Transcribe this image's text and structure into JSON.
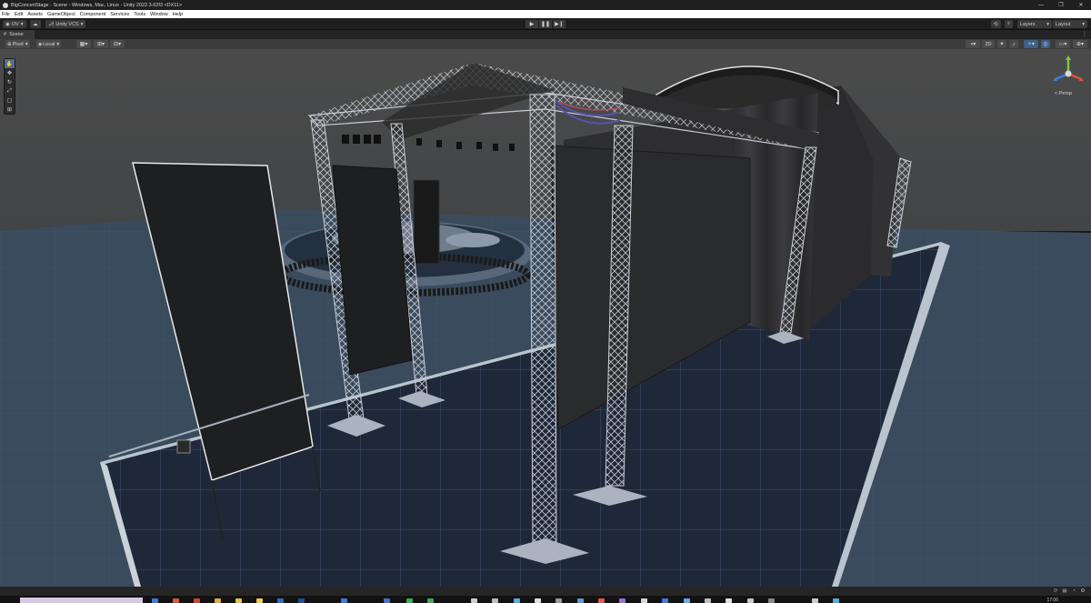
{
  "window": {
    "title": "BigConcertStage - Scene - Windows, Mac, Linux - Unity 2022.3.62f3 <DX11>",
    "controls": [
      "—",
      "❐",
      "✕"
    ]
  },
  "menu": [
    "File",
    "Edit",
    "Assets",
    "GameObject",
    "Component",
    "Services",
    "Tools",
    "Window",
    "Help"
  ],
  "toolbar": {
    "account": "OV",
    "vcs": "Unity VCS",
    "play": "▶",
    "pause": "❚❚",
    "step": "▶❙",
    "layers": "Layers",
    "layout": "Layout"
  },
  "scene_tab": {
    "label": "Scene"
  },
  "scene_toolbar": {
    "pivot": "Pivot",
    "local": "Local",
    "mode_2d": "2D"
  },
  "gizmo": {
    "label": "< Persp"
  },
  "taskbar": {
    "time": "17:06"
  },
  "colors": {
    "sky": "#4a4a4a",
    "ground": "#3a4c5e",
    "floor": "#1e2735",
    "truss": "#b8bcc4",
    "accent": "#3e5f8a"
  }
}
